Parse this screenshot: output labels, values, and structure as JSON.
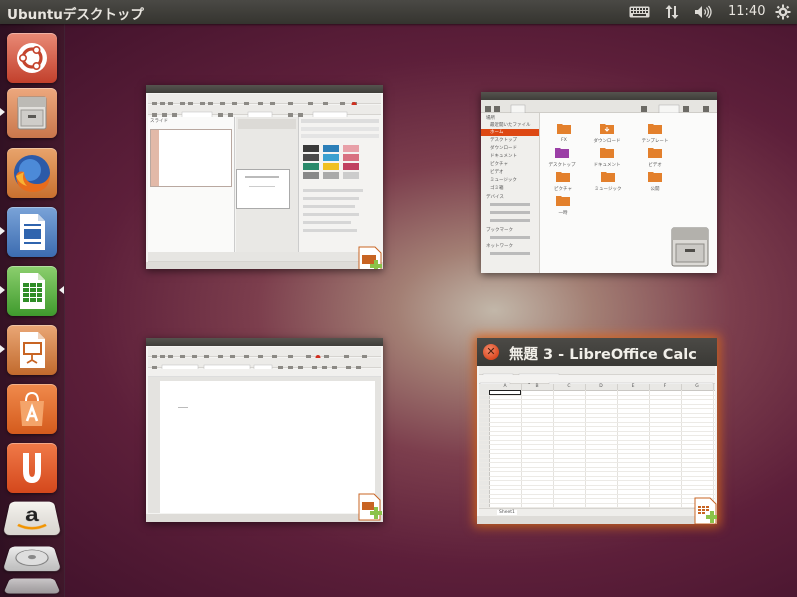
{
  "panel": {
    "title": "Ubuntuデスクトップ",
    "clock": "11:40",
    "indicators": [
      "keyboard-icon",
      "network-icon",
      "volume-icon",
      "power-gear-icon"
    ]
  },
  "launcher": {
    "items": [
      {
        "name": "dash-home",
        "icon": "ubuntu-logo-icon"
      },
      {
        "name": "files",
        "icon": "file-cabinet-icon",
        "running": true
      },
      {
        "name": "firefox",
        "icon": "firefox-icon"
      },
      {
        "name": "writer",
        "icon": "libreoffice-writer-icon",
        "running": true
      },
      {
        "name": "calc",
        "icon": "libreoffice-calc-icon",
        "running": true,
        "focused": true
      },
      {
        "name": "impress",
        "icon": "libreoffice-impress-icon",
        "running": true
      },
      {
        "name": "software-center",
        "icon": "shopping-bag-icon"
      },
      {
        "name": "ubuntu-one",
        "icon": "ubuntu-one-icon"
      },
      {
        "name": "amazon",
        "icon": "amazon-icon"
      },
      {
        "name": "disk",
        "icon": "disk-icon"
      }
    ]
  },
  "windows": {
    "impress": {
      "sidebar_heading": "スライド"
    },
    "files": {
      "places": [
        "最近開いたファイル",
        "ホーム",
        "デスクトップ",
        "ダウンロード",
        "ドキュメント",
        "ピクチャ",
        "ビデオ",
        "ミュージック",
        "ゴミ箱"
      ],
      "devices_header": "デバイス",
      "bookmarks_header": "ブックマーク",
      "network_header": "ネットワーク",
      "folders": [
        "FX",
        "ダウンロード",
        "テンプレート",
        "デスクトップ",
        "ドキュメント",
        "ビデオ",
        "ピクチャ",
        "ミュージック",
        "公開",
        "一時"
      ]
    },
    "writer": {},
    "calc": {
      "title": "無題 3 - LibreOffice Calc",
      "sheet_tab": "Sheet1",
      "columns": [
        "A",
        "B",
        "C",
        "D",
        "E",
        "F",
        "G"
      ]
    }
  },
  "colors": {
    "accent": "#dd4814",
    "folder": "#e3802c",
    "panel": "#3c3b37"
  }
}
